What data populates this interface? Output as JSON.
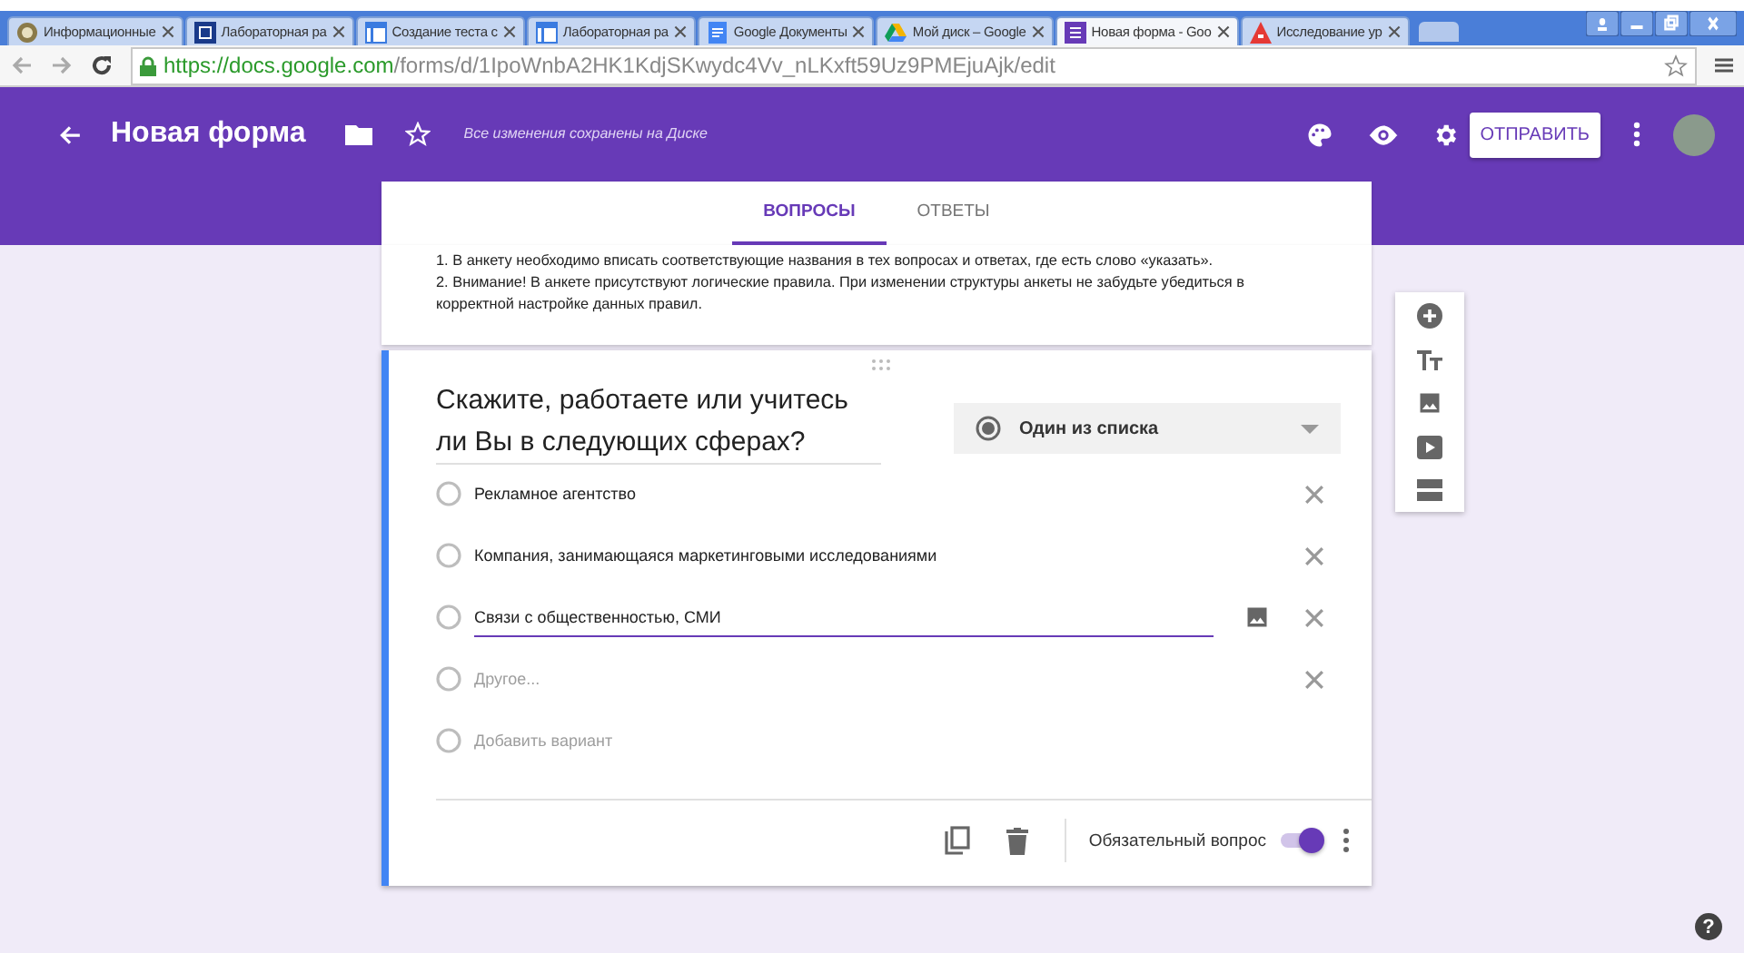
{
  "browser": {
    "tabs": [
      {
        "title": "Информационные",
        "kind": "globe",
        "selected": false
      },
      {
        "title": "Лабораторная ра",
        "kind": "letter-d",
        "selected": false
      },
      {
        "title": "Создание теста с",
        "kind": "slides",
        "selected": false
      },
      {
        "title": "Лабораторная ра",
        "kind": "slides",
        "selected": false
      },
      {
        "title": "Google Документы",
        "kind": "docs",
        "selected": false
      },
      {
        "title": "Мой диск – Google",
        "kind": "drive",
        "selected": false
      },
      {
        "title": "Новая форма - Goo",
        "kind": "forms",
        "selected": true
      },
      {
        "title": "Исследование ур",
        "kind": "alert",
        "selected": false
      }
    ],
    "url_host": "https://docs.google.com",
    "url_path": "/forms/d/1IpoWnbA2HK1KdjSKwydc4Vv_nLKxft59Uz9PMEjuAjk/edit"
  },
  "header": {
    "title": "Новая форма",
    "save_status": "Все изменения сохранены на Диске",
    "send_button": "ОТПРАВИТЬ"
  },
  "form_tabs": [
    {
      "label": "ВОПРОСЫ",
      "selected": true
    },
    {
      "label": "ОТВЕТЫ",
      "selected": false
    }
  ],
  "description": [
    "1. В анкету необходимо вписать соответствующие названия в тех вопросах и ответах, где есть слово «указать».",
    "2. Внимание! В анкете присутствуют логические правила. При изменении структуры анкеты не забудьте убедиться в корректной настройке данных правил."
  ],
  "question": {
    "title": "Скажите, работаете или учитесь ли Вы в следующих сферах?",
    "type": "Один из списка",
    "options": [
      {
        "text": "Рекламное агентство",
        "kind": "option",
        "focused": false
      },
      {
        "text": "Компания, занимающаяся маркетинговыми исследованиями",
        "kind": "option",
        "focused": false
      },
      {
        "text": "Связи с общественностью, СМИ",
        "kind": "option",
        "focused": true
      },
      {
        "text": "Другое...",
        "kind": "other",
        "focused": false
      },
      {
        "text": "Добавить вариант",
        "kind": "add",
        "focused": false
      }
    ],
    "required_label": "Обязательный вопрос",
    "required": true
  },
  "help": "?"
}
